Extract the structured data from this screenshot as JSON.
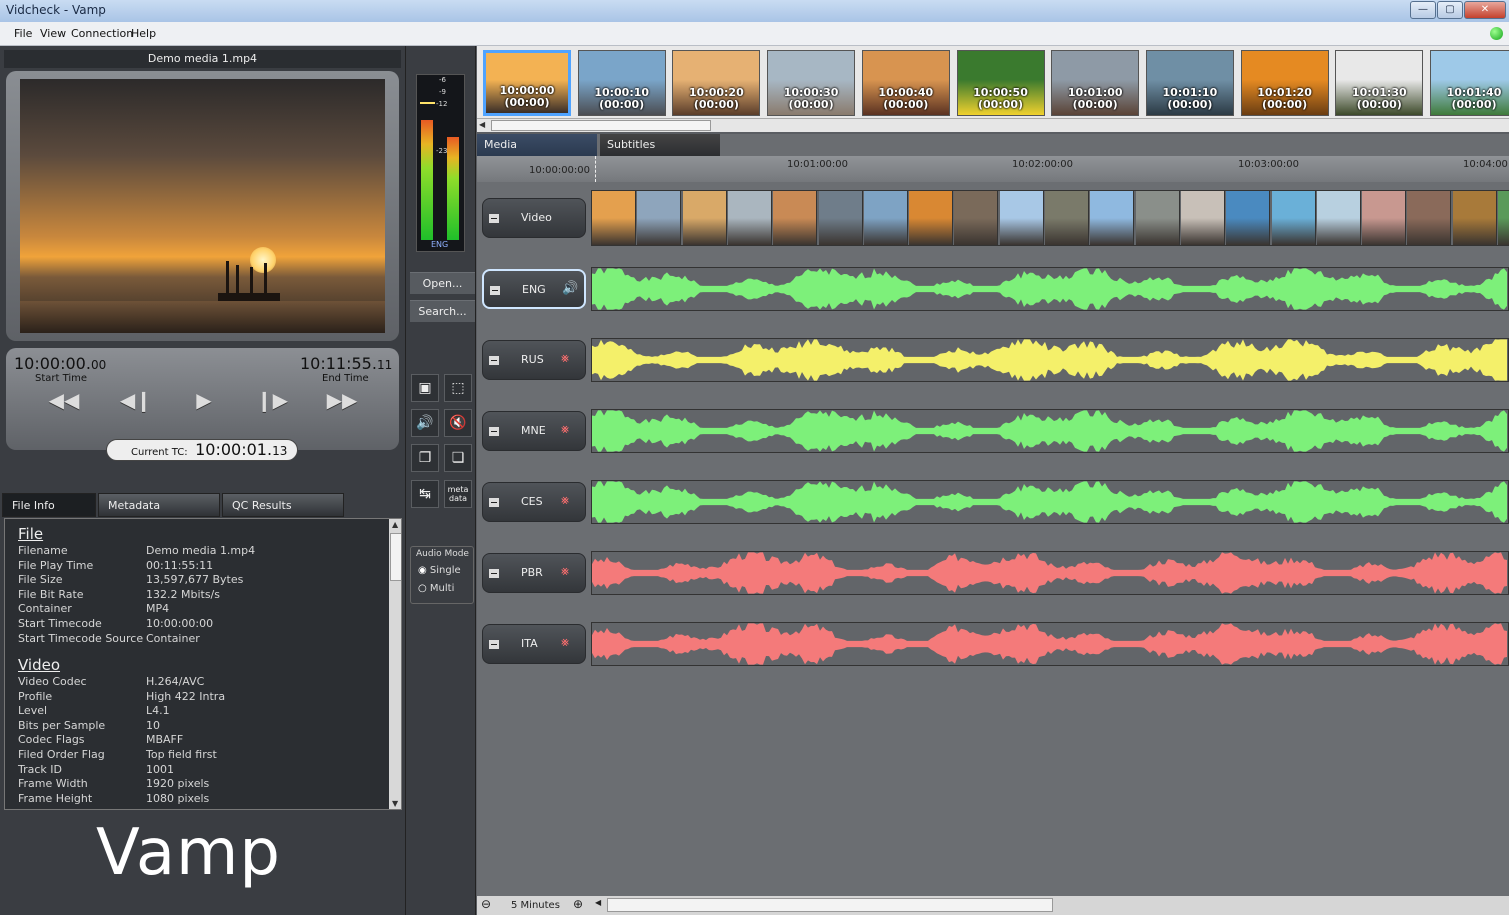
{
  "window": {
    "title": "Vidcheck - Vamp",
    "min": "—",
    "max": "▢",
    "close": "✕"
  },
  "menu": [
    "File",
    "View",
    "Connection",
    "Help"
  ],
  "player": {
    "filename": "Demo media 1.mp4",
    "start_tc_main": "10:00:00.",
    "start_tc_frames": "00",
    "start_label": "Start Time",
    "end_tc_main": "10:11:55.",
    "end_tc_frames": "11",
    "end_label": "End Time",
    "current_label": "Current TC:",
    "current_main": "10:00:01.",
    "current_frames": "13"
  },
  "tabs": [
    "File Info",
    "Metadata",
    "QC Results"
  ],
  "file_info": {
    "file_heading": "File",
    "file_rows": [
      {
        "k": "Filename",
        "v": "Demo media 1.mp4"
      },
      {
        "k": "File Play Time",
        "v": "00:11:55:11"
      },
      {
        "k": "File Size",
        "v": "13,597,677 Bytes"
      },
      {
        "k": "File Bit Rate",
        "v": "132.2 Mbits/s"
      },
      {
        "k": "Container",
        "v": "MP4"
      },
      {
        "k": "Start Timecode",
        "v": "10:00:00:00"
      },
      {
        "k": "Start Timecode Source",
        "v": "Container"
      }
    ],
    "video_heading": "Video",
    "video_rows": [
      {
        "k": "Video Codec",
        "v": "H.264/AVC"
      },
      {
        "k": "Profile",
        "v": "High 422 Intra"
      },
      {
        "k": "Level",
        "v": "L4.1"
      },
      {
        "k": "Bits per Sample",
        "v": "10"
      },
      {
        "k": "Codec Flags",
        "v": "MBAFF"
      },
      {
        "k": "Filed Order Flag",
        "v": "Top field first"
      },
      {
        "k": "Track ID",
        "v": "1001"
      },
      {
        "k": "Frame Width",
        "v": "1920 pixels"
      },
      {
        "k": "Frame Height",
        "v": "1080 pixels"
      }
    ]
  },
  "logo": "Vamp",
  "meter": {
    "ticks": [
      "-6",
      "-9",
      "-12",
      "-23"
    ],
    "lang": "ENG"
  },
  "mid_buttons": {
    "open": "Open...",
    "search": "Search..."
  },
  "tools": {
    "meta": "meta\ndata"
  },
  "audio_mode": {
    "label": "Audio Mode",
    "single": "Single",
    "multi": "Multi"
  },
  "thumbs": [
    {
      "tc": "10:00:00",
      "sub": "(00:00)",
      "c1": "#f3b253",
      "c2": "#3a2e28"
    },
    {
      "tc": "10:00:10",
      "sub": "(00:00)",
      "c1": "#7aa5c9",
      "c2": "#4b4d52"
    },
    {
      "tc": "10:00:20",
      "sub": "(00:00)",
      "c1": "#e6b173",
      "c2": "#5a3d2a"
    },
    {
      "tc": "10:00:30",
      "sub": "(00:00)",
      "c1": "#a7b7c4",
      "c2": "#8a7b6d"
    },
    {
      "tc": "10:00:40",
      "sub": "(00:00)",
      "c1": "#d89450",
      "c2": "#5a3222"
    },
    {
      "tc": "10:00:50",
      "sub": "(00:00)",
      "c1": "#3a7a2e",
      "c2": "#f0d12e"
    },
    {
      "tc": "10:01:00",
      "sub": "(00:00)",
      "c1": "#8e9aa6",
      "c2": "#5a4336"
    },
    {
      "tc": "10:01:10",
      "sub": "(00:00)",
      "c1": "#6f8fa5",
      "c2": "#2c3a44"
    },
    {
      "tc": "10:01:20",
      "sub": "(00:00)",
      "c1": "#e58a22",
      "c2": "#6a3d12"
    },
    {
      "tc": "10:01:30",
      "sub": "(00:00)",
      "c1": "#e8e8e8",
      "c2": "#3d4a2a"
    },
    {
      "tc": "10:01:40",
      "sub": "(00:00)",
      "c1": "#9ec9e8",
      "c2": "#3f7a3a"
    }
  ],
  "right_tabs": [
    "Media",
    "Subtitles"
  ],
  "ruler": {
    "start": "10:00:00:00",
    "marks": [
      "10:01:00:00",
      "10:02:00:00",
      "10:03:00:00",
      "10:04:00:"
    ]
  },
  "tracks": [
    {
      "name": "Video",
      "type": "video"
    },
    {
      "name": "ENG",
      "type": "audio",
      "color": "#7df07a",
      "seed": 1,
      "selected": true
    },
    {
      "name": "RUS",
      "type": "audio",
      "color": "#f4f06a",
      "seed": 2
    },
    {
      "name": "MNE",
      "type": "audio",
      "color": "#7df07a",
      "seed": 1
    },
    {
      "name": "CES",
      "type": "audio",
      "color": "#7df07a",
      "seed": 1
    },
    {
      "name": "PBR",
      "type": "audio",
      "color": "#f47a7a",
      "seed": 3
    },
    {
      "name": "ITA",
      "type": "audio",
      "color": "#f47a7a",
      "seed": 3
    }
  ],
  "video_strip_colors": [
    "#e4a04e",
    "#8ea5bc",
    "#d9a968",
    "#aab6bf",
    "#c98a55",
    "#6f7d8a",
    "#7ea3c4",
    "#d98833",
    "#7a6a5a",
    "#a8c8e6",
    "#7a7a6a",
    "#8fb9e0",
    "#8a8f8a",
    "#c8c0b8",
    "#4a8ac0",
    "#6ab0d8",
    "#b8d0e0",
    "#c89890",
    "#8a6a5a",
    "#a87a3a",
    "#5a9a5a"
  ],
  "bottom": {
    "zoom": "5 Minutes"
  }
}
